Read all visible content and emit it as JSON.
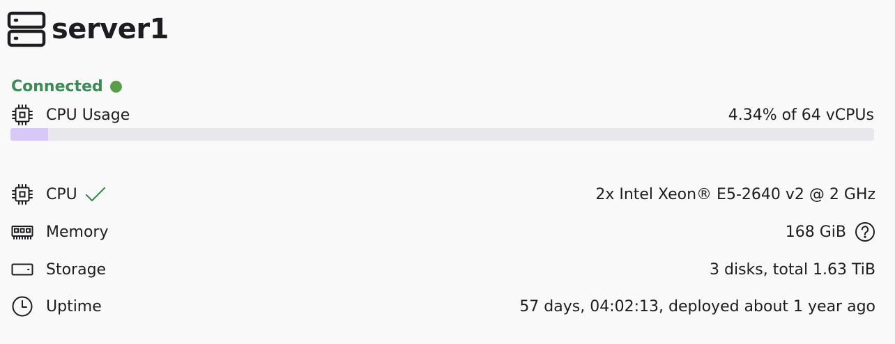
{
  "server": {
    "name": "server1",
    "icon": "server-icon"
  },
  "status": {
    "label": "Connected",
    "color": "#3e8a57",
    "dot_color": "#5a9e4b"
  },
  "cpu_usage": {
    "label": "CPU Usage",
    "icon": "cpu-icon",
    "value_text": "4.34% of 64 vCPUs",
    "percent": 4.34,
    "bar_color": "#d8c8f8",
    "track_color": "#e8e8ec"
  },
  "specs": [
    {
      "key": "cpu",
      "label": "CPU",
      "icon": "cpu-icon",
      "value": "2x Intel Xeon® E5-2640 v2 @ 2 GHz",
      "extra": "check-icon"
    },
    {
      "key": "memory",
      "label": "Memory",
      "icon": "memory-icon",
      "value": "168 GiB",
      "extra": "help-icon"
    },
    {
      "key": "storage",
      "label": "Storage",
      "icon": "storage-icon",
      "value": "3 disks, total 1.63 TiB"
    },
    {
      "key": "uptime",
      "label": "Uptime",
      "icon": "clock-icon",
      "value": "57 days, 04:02:13, deployed about 1 year ago"
    }
  ]
}
